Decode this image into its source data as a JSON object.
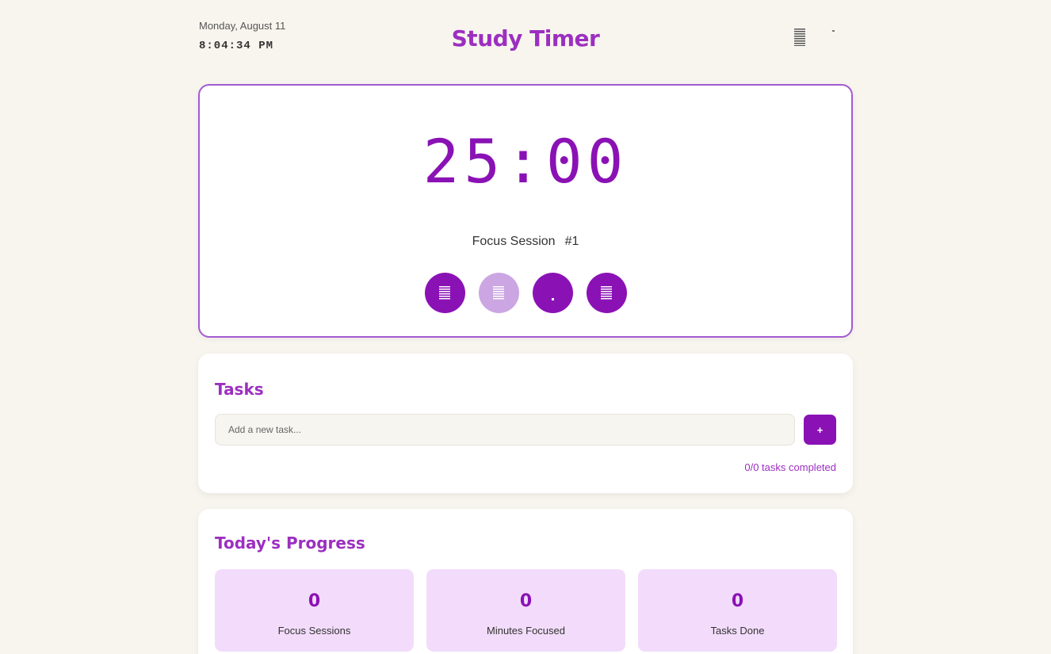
{
  "header": {
    "date": "Monday, August 11",
    "time": "8:04:34 PM",
    "title": "Study Timer",
    "menu_icon": "menu-icon"
  },
  "timer": {
    "display": "25:00",
    "session_label": "Focus Session",
    "session_number": "#1",
    "controls": [
      {
        "icon": "lines-icon",
        "enabled": true
      },
      {
        "icon": "lines-icon",
        "enabled": false
      },
      {
        "icon": "dot-icon",
        "enabled": true
      },
      {
        "icon": "lines-icon",
        "enabled": true
      }
    ]
  },
  "tasks": {
    "title": "Tasks",
    "input_placeholder": "Add a new task...",
    "add_label": "+",
    "count_text": "0/0 tasks completed"
  },
  "progress": {
    "title": "Today's Progress",
    "stats": [
      {
        "value": "0",
        "label": "Focus Sessions"
      },
      {
        "value": "0",
        "label": "Minutes Focused"
      },
      {
        "value": "0",
        "label": "Tasks Done"
      }
    ]
  },
  "colors": {
    "accent": "#8a12b5",
    "title": "#9c2fc0",
    "background": "#f7f5ee",
    "stat_bg": "#f3dcfb"
  }
}
